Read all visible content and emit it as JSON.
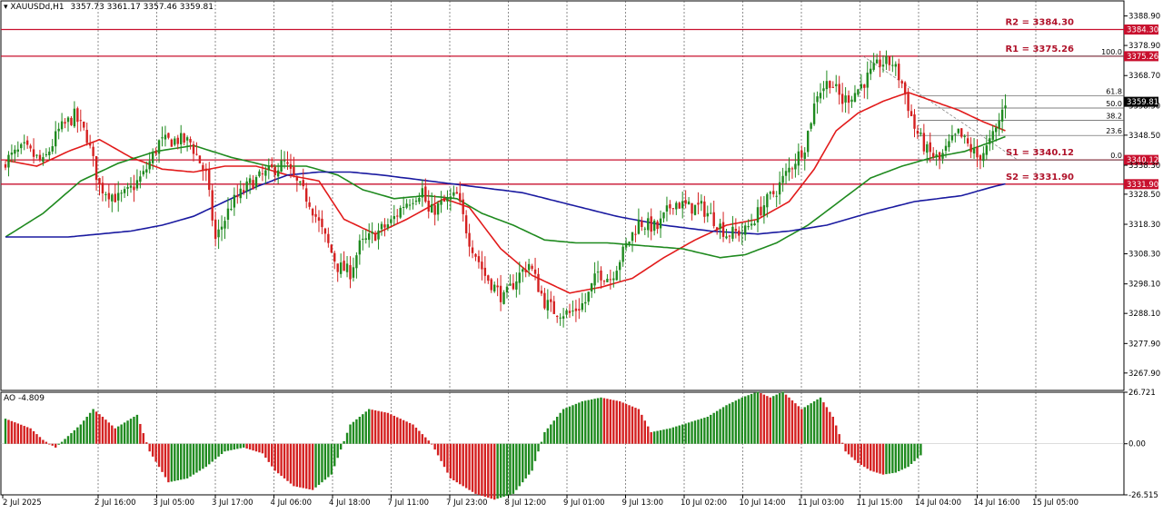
{
  "header": {
    "symbol": "XAUUSDd,H1",
    "ohlc": "3357.73 3361.17 3357.46 3359.81",
    "ao_label": "AO -4.809"
  },
  "colors": {
    "bull": "#1f8a1f",
    "bear": "#d42020",
    "ma_fast": "#e21b1b",
    "ma_mid": "#1f8a1f",
    "ma_slow": "#1a1aa0",
    "level_line": "#c8102e",
    "label_text": "#b0122a",
    "price_box": "#000000"
  },
  "chart_data": [
    {
      "type": "candlestick",
      "symbol": "XAUUSDd",
      "timeframe": "H1",
      "ylim": [
        3262,
        3394
      ],
      "y_ticks": [
        "3388.90",
        "3378.90",
        "3368.70",
        "3358.50",
        "3348.50",
        "3338.30",
        "3328.50",
        "3318.30",
        "3308.30",
        "3298.10",
        "3288.10",
        "3277.90",
        "3267.90"
      ],
      "x_labels": [
        "2 Jul 2025",
        "2 Jul 16:00",
        "3 Jul 05:00",
        "3 Jul 17:00",
        "4 Jul 06:00",
        "4 Jul 18:00",
        "7 Jul 11:00",
        "7 Jul 23:00",
        "8 Jul 12:00",
        "9 Jul 01:00",
        "9 Jul 13:00",
        "10 Jul 02:00",
        "10 Jul 14:00",
        "11 Jul 03:00",
        "11 Jul 15:00",
        "14 Jul 04:00",
        "14 Jul 16:00",
        "15 Jul 05:00"
      ],
      "last_price": "3359.81",
      "close_path": [
        [
          0,
          3340
        ],
        [
          6,
          3344
        ],
        [
          12,
          3339
        ],
        [
          17,
          3350
        ],
        [
          22,
          3355
        ],
        [
          26,
          3348
        ],
        [
          30,
          3331
        ],
        [
          36,
          3327
        ],
        [
          39,
          3329
        ],
        [
          44,
          3335
        ],
        [
          49,
          3346
        ],
        [
          55,
          3347
        ],
        [
          59,
          3346
        ],
        [
          64,
          3335
        ],
        [
          67,
          3313
        ],
        [
          72,
          3325
        ],
        [
          78,
          3332
        ],
        [
          84,
          3336
        ],
        [
          89,
          3339
        ],
        [
          93,
          3332
        ],
        [
          97,
          3326
        ],
        [
          101,
          3316
        ],
        [
          106,
          3304
        ],
        [
          110,
          3302
        ],
        [
          113,
          3311
        ],
        [
          118,
          3315
        ],
        [
          123,
          3319
        ],
        [
          127,
          3325
        ],
        [
          133,
          3330
        ],
        [
          135,
          3322
        ],
        [
          139,
          3325
        ],
        [
          144,
          3328
        ],
        [
          148,
          3313
        ],
        [
          153,
          3301
        ],
        [
          159,
          3293
        ],
        [
          163,
          3300
        ],
        [
          167,
          3305
        ],
        [
          172,
          3292
        ],
        [
          175,
          3289
        ],
        [
          180,
          3288
        ],
        [
          185,
          3292
        ],
        [
          189,
          3302
        ],
        [
          193,
          3300
        ],
        [
          198,
          3311
        ],
        [
          202,
          3319
        ],
        [
          208,
          3317
        ],
        [
          213,
          3326
        ],
        [
          218,
          3324
        ],
        [
          222,
          3324
        ],
        [
          227,
          3319
        ],
        [
          230,
          3315
        ],
        [
          236,
          3316
        ],
        [
          242,
          3325
        ],
        [
          246,
          3330
        ],
        [
          250,
          3337
        ],
        [
          255,
          3345
        ],
        [
          259,
          3363
        ],
        [
          263,
          3367
        ],
        [
          267,
          3360
        ],
        [
          271,
          3363
        ],
        [
          275,
          3368
        ],
        [
          279,
          3373
        ],
        [
          283,
          3373
        ],
        [
          286,
          3366
        ],
        [
          290,
          3351
        ],
        [
          294,
          3343
        ],
        [
          298,
          3340
        ],
        [
          301,
          3345
        ],
        [
          304,
          3349
        ],
        [
          307,
          3345
        ],
        [
          310,
          3341
        ],
        [
          313,
          3344
        ],
        [
          316,
          3350
        ],
        [
          319,
          3360
        ]
      ],
      "moving_averages": [
        {
          "name": "MA fast",
          "color": "#e21b1b",
          "path": [
            [
              0,
              3340
            ],
            [
              10,
              3338
            ],
            [
              20,
              3343
            ],
            [
              30,
              3347
            ],
            [
              40,
              3341
            ],
            [
              50,
              3337
            ],
            [
              60,
              3336
            ],
            [
              70,
              3338
            ],
            [
              80,
              3338
            ],
            [
              90,
              3335
            ],
            [
              100,
              3333
            ],
            [
              108,
              3320
            ],
            [
              118,
              3315
            ],
            [
              128,
              3320
            ],
            [
              140,
              3327
            ],
            [
              148,
              3324
            ],
            [
              158,
              3310
            ],
            [
              168,
              3301
            ],
            [
              180,
              3295
            ],
            [
              190,
              3297
            ],
            [
              200,
              3300
            ],
            [
              210,
              3307
            ],
            [
              220,
              3313
            ],
            [
              230,
              3318
            ],
            [
              240,
              3320
            ],
            [
              250,
              3326
            ],
            [
              258,
              3337
            ],
            [
              265,
              3350
            ],
            [
              272,
              3356
            ],
            [
              280,
              3360
            ],
            [
              288,
              3363
            ],
            [
              296,
              3360
            ],
            [
              304,
              3357
            ],
            [
              312,
              3353
            ],
            [
              319,
              3350
            ]
          ]
        },
        {
          "name": "MA mid",
          "color": "#1f8a1f",
          "path": [
            [
              0,
              3314
            ],
            [
              12,
              3322
            ],
            [
              24,
              3333
            ],
            [
              36,
              3339
            ],
            [
              48,
              3343
            ],
            [
              60,
              3345
            ],
            [
              72,
              3341
            ],
            [
              84,
              3338
            ],
            [
              96,
              3338
            ],
            [
              106,
              3335
            ],
            [
              114,
              3330
            ],
            [
              124,
              3327
            ],
            [
              134,
              3328
            ],
            [
              144,
              3327
            ],
            [
              152,
              3322
            ],
            [
              162,
              3318
            ],
            [
              172,
              3313
            ],
            [
              182,
              3312
            ],
            [
              192,
              3312
            ],
            [
              204,
              3311
            ],
            [
              216,
              3310
            ],
            [
              228,
              3307
            ],
            [
              236,
              3308
            ],
            [
              246,
              3312
            ],
            [
              256,
              3318
            ],
            [
              266,
              3326
            ],
            [
              276,
              3334
            ],
            [
              286,
              3338
            ],
            [
              296,
              3341
            ],
            [
              306,
              3343
            ],
            [
              314,
              3346
            ],
            [
              319,
              3348
            ]
          ]
        },
        {
          "name": "MA slow",
          "color": "#1a1aa0",
          "path": [
            [
              0,
              3314
            ],
            [
              20,
              3314
            ],
            [
              30,
              3315
            ],
            [
              40,
              3316
            ],
            [
              50,
              3318
            ],
            [
              60,
              3321
            ],
            [
              70,
              3326
            ],
            [
              80,
              3331
            ],
            [
              90,
              3335
            ],
            [
              100,
              3336
            ],
            [
              110,
              3336
            ],
            [
              120,
              3335
            ],
            [
              135,
              3333
            ],
            [
              150,
              3331
            ],
            [
              165,
              3329
            ],
            [
              180,
              3325
            ],
            [
              195,
              3321
            ],
            [
              210,
              3318
            ],
            [
              225,
              3316
            ],
            [
              240,
              3315
            ],
            [
              250,
              3316
            ],
            [
              262,
              3318
            ],
            [
              275,
              3322
            ],
            [
              290,
              3326
            ],
            [
              305,
              3328
            ],
            [
              315,
              3331
            ],
            [
              319,
              3332
            ]
          ]
        }
      ],
      "levels": [
        {
          "name": "R2",
          "label": "R2 = 3384.30",
          "price": 3384.3,
          "price_text": "3384.30"
        },
        {
          "name": "R1",
          "label": "R1 = 3375.26",
          "price": 3375.26,
          "price_text": "3375.26"
        },
        {
          "name": "S1",
          "label": "S1 = 3340.12",
          "price": 3340.12,
          "price_text": "3340.12"
        },
        {
          "name": "S2",
          "label": "S2 = 3331.90",
          "price": 3331.9,
          "price_text": "3331.90"
        }
      ],
      "fibonacci": [
        {
          "label": "100.0",
          "price": 3375.26
        },
        {
          "label": "61.8",
          "price": 3361.9
        },
        {
          "label": "50.0",
          "price": 3357.7
        },
        {
          "label": "38.2",
          "price": 3353.5
        },
        {
          "label": "23.6",
          "price": 3348.4
        },
        {
          "label": "0.0",
          "price": 3340.12
        }
      ]
    },
    {
      "type": "bar",
      "name": "AO",
      "indicator": "Awesome Oscillator",
      "ylim": [
        -26.515,
        26.721
      ],
      "y_ticks": [
        "26.721",
        "0.00",
        "-26.515"
      ],
      "path": [
        [
          0,
          13
        ],
        [
          8,
          8
        ],
        [
          12,
          2
        ],
        [
          16,
          -2
        ],
        [
          20,
          4
        ],
        [
          24,
          10
        ],
        [
          28,
          18
        ],
        [
          31,
          14
        ],
        [
          35,
          8
        ],
        [
          39,
          12
        ],
        [
          42,
          15
        ],
        [
          46,
          -4
        ],
        [
          52,
          -20
        ],
        [
          58,
          -18
        ],
        [
          64,
          -12
        ],
        [
          70,
          -4
        ],
        [
          76,
          -2
        ],
        [
          82,
          -5
        ],
        [
          86,
          -14
        ],
        [
          92,
          -22
        ],
        [
          98,
          -24
        ],
        [
          104,
          -16
        ],
        [
          110,
          10
        ],
        [
          116,
          18
        ],
        [
          122,
          16
        ],
        [
          130,
          10
        ],
        [
          136,
          0
        ],
        [
          142,
          -18
        ],
        [
          150,
          -26
        ],
        [
          156,
          -29
        ],
        [
          162,
          -26
        ],
        [
          168,
          -14
        ],
        [
          172,
          6
        ],
        [
          178,
          18
        ],
        [
          184,
          22
        ],
        [
          190,
          24
        ],
        [
          196,
          22
        ],
        [
          202,
          18
        ],
        [
          206,
          6
        ],
        [
          212,
          8
        ],
        [
          218,
          11
        ],
        [
          224,
          14
        ],
        [
          230,
          20
        ],
        [
          235,
          24
        ],
        [
          240,
          27
        ],
        [
          244,
          24
        ],
        [
          248,
          27
        ],
        [
          254,
          18
        ],
        [
          260,
          24
        ],
        [
          264,
          14
        ],
        [
          268,
          -4
        ],
        [
          272,
          -10
        ],
        [
          276,
          -14
        ],
        [
          280,
          -16
        ],
        [
          284,
          -15
        ],
        [
          288,
          -12
        ],
        [
          292,
          -6
        ]
      ]
    }
  ]
}
